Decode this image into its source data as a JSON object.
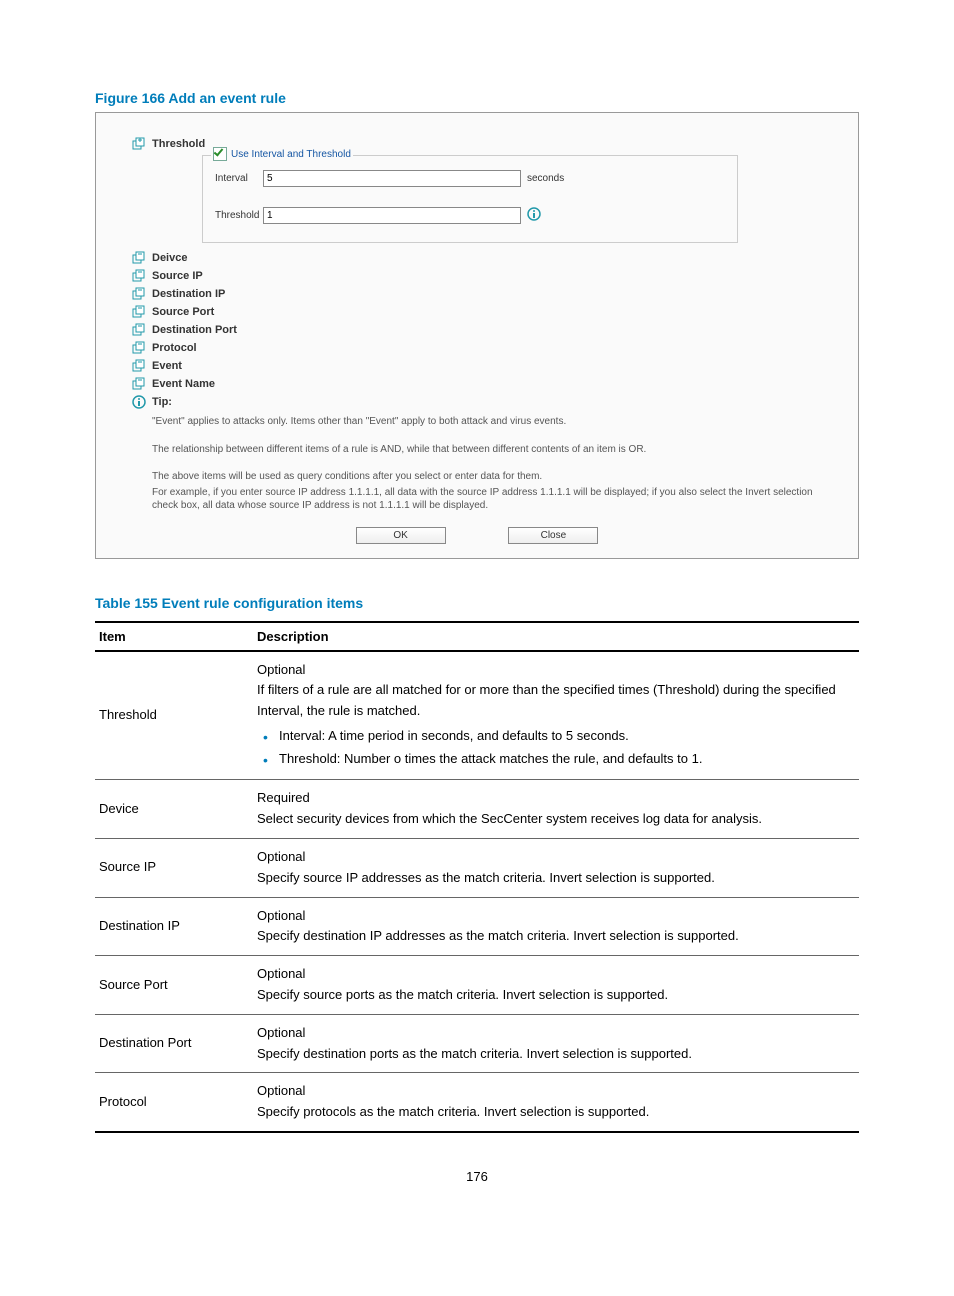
{
  "figure": {
    "title": "Figure 166 Add an event rule",
    "sections": {
      "threshold": "Threshold",
      "use_interval": "Use Interval and Threshold",
      "interval_label": "Interval",
      "interval_value": "5",
      "interval_unit": "seconds",
      "threshold_label": "Threshold",
      "threshold_value": "1",
      "device": "Deivce",
      "source_ip": "Source IP",
      "destination_ip": "Destination IP",
      "source_port": "Source Port",
      "destination_port": "Destination Port",
      "protocol": "Protocol",
      "event": "Event",
      "event_name": "Event Name",
      "tip_label": "Tip:"
    },
    "tips": {
      "p1": "\"Event\" applies to attacks only. Items other than \"Event\" apply to both attack and virus events.",
      "p2": "The relationship between different items of a rule is AND, while that between different contents of an item is OR.",
      "p3": "The above items will be used as query conditions after you select or enter data for them.",
      "p4": "For example, if you enter source IP address 1.1.1.1, all data with the source IP address 1.1.1.1 will be displayed; if you also select the Invert selection check box, all data whose source IP address is not 1.1.1.1 will be displayed."
    },
    "buttons": {
      "ok": "OK",
      "close": "Close"
    }
  },
  "table": {
    "title": "Table 155 Event rule configuration items",
    "headers": {
      "item": "Item",
      "description": "Description"
    },
    "rows": [
      {
        "item": "Threshold",
        "desc_lines": [
          "Optional",
          "If filters of a rule are all matched for or more than the specified times (Threshold) during the specified Interval, the rule is matched."
        ],
        "bullets": [
          "Interval: A time period in seconds, and defaults to 5 seconds.",
          "Threshold: Number o times the attack matches the rule, and defaults to 1."
        ]
      },
      {
        "item": "Device",
        "desc_lines": [
          "Required",
          "Select security devices from which the SecCenter system receives log data for analysis."
        ]
      },
      {
        "item": "Source IP",
        "desc_lines": [
          "Optional",
          "Specify source IP addresses as the match criteria. Invert selection is supported."
        ]
      },
      {
        "item": "Destination IP",
        "desc_lines": [
          "Optional",
          "Specify destination IP addresses as the match criteria. Invert selection is supported."
        ]
      },
      {
        "item": "Source Port",
        "desc_lines": [
          "Optional",
          "Specify source ports as the match criteria. Invert selection is supported."
        ]
      },
      {
        "item": "Destination Port",
        "desc_lines": [
          "Optional",
          "Specify destination ports as the match criteria. Invert selection is supported."
        ]
      },
      {
        "item": "Protocol",
        "desc_lines": [
          "Optional",
          "Specify protocols as the match criteria. Invert selection is supported."
        ]
      }
    ]
  },
  "page_number": "176"
}
